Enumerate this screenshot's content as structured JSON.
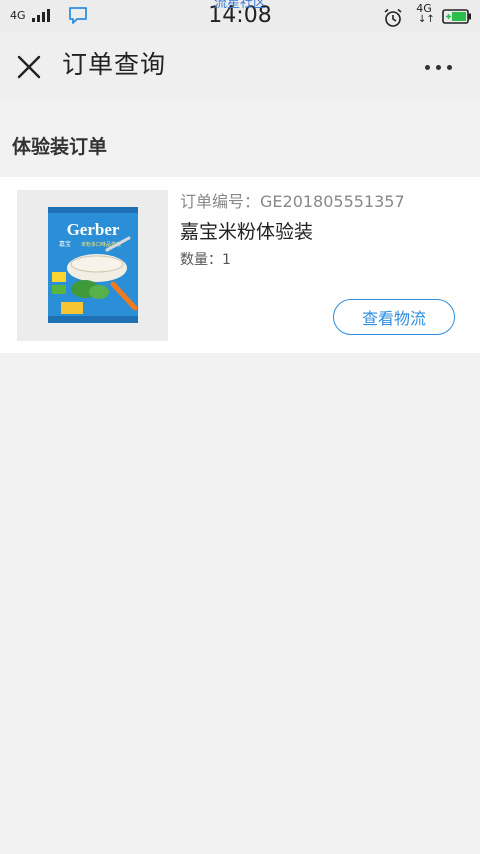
{
  "status_bar": {
    "network_left": "4G",
    "time": "14:08",
    "overlay_text": "流星社区",
    "network_right": "4G",
    "network_arrows": "↓↑",
    "icons": [
      "signal-icon",
      "chat-bubble-icon",
      "alarm-clock-icon",
      "battery-icon"
    ]
  },
  "nav": {
    "title": "订单查询",
    "close_icon": "close-icon",
    "more_icon": "more-dots-icon"
  },
  "section": {
    "title": "体验装订单"
  },
  "order": {
    "order_number": "订单编号：GE201805551357",
    "product_name": "嘉宝米粉体验装",
    "quantity": "数量：1",
    "logistics_button": "查看物流",
    "image": {
      "brand": "Gerber",
      "brand_cn": "嘉宝",
      "subtitle": "米粉多口味品尝装"
    }
  },
  "colors": {
    "accent": "#2f8ee0",
    "background": "#f2f2f2",
    "card": "#ffffff",
    "overlay": "#3a7bd5"
  }
}
